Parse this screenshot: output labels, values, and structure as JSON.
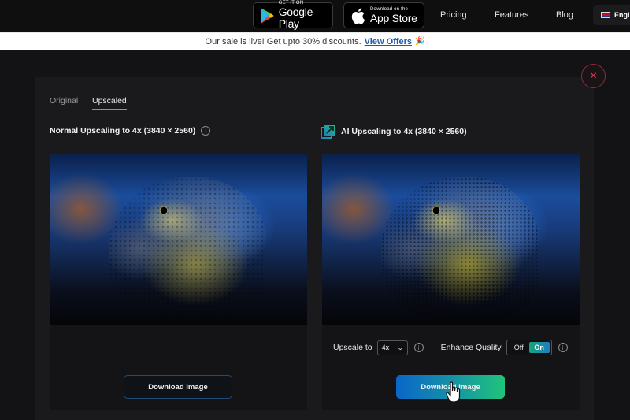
{
  "topbar": {
    "google_play": {
      "small": "GET IT ON",
      "big": "Google Play",
      "icon": "google-play-icon"
    },
    "app_store": {
      "small": "Download on the",
      "big": "App Store",
      "icon": "apple-icon"
    },
    "nav": [
      {
        "label": "Pricing"
      },
      {
        "label": "Features"
      },
      {
        "label": "Blog"
      }
    ],
    "language": {
      "label": "English",
      "flag": "uk-flag-icon"
    }
  },
  "banner": {
    "text": "Our sale is live! Get upto 30% discounts.",
    "link": "View Offers",
    "emoji": "🎉"
  },
  "modal": {
    "close_icon": "×",
    "tabs": [
      {
        "label": "Original",
        "active": false
      },
      {
        "label": "Upscaled",
        "active": true
      }
    ],
    "left_panel": {
      "title": "Normal Upscaling to 4x (3840 × 2560)",
      "info_icon": "i",
      "download_label": "Download Image"
    },
    "right_panel": {
      "title": "AI Upscaling to 4x (3840 × 2560)",
      "upscale_label": "Upscale to",
      "upscale_value": "4x",
      "enhance_label": "Enhance Quality",
      "toggle_off": "Off",
      "toggle_on": "On",
      "enhance_state": "On",
      "download_label": "Download Image",
      "info_icon": "i"
    }
  },
  "colors": {
    "accent_green": "#2ecc71",
    "close_red": "#e0405a",
    "gradient_start": "#0a66c9",
    "gradient_end": "#1fc47a",
    "link_blue": "#1e5aa8"
  }
}
